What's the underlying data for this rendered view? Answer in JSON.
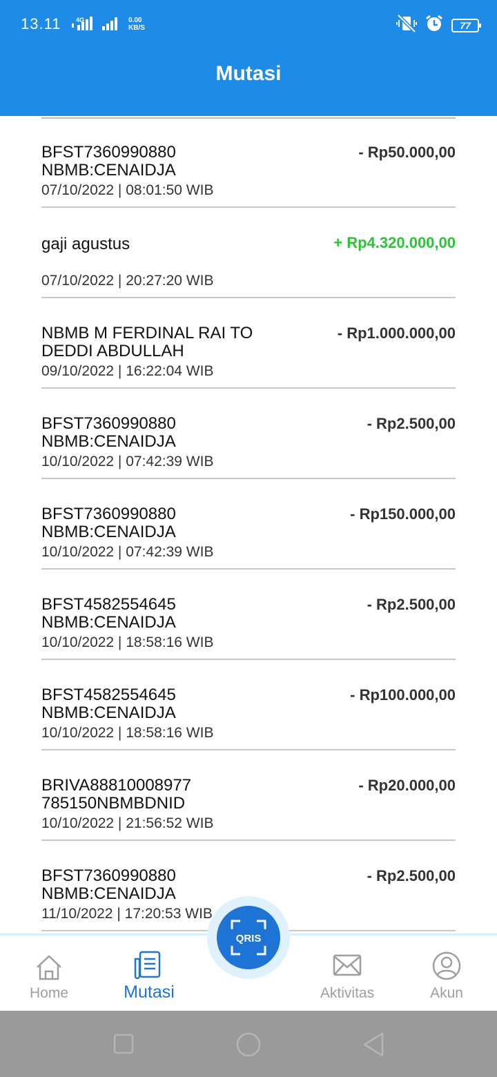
{
  "statusbar": {
    "time": "13.11",
    "network": "4G",
    "speed_value": "0.00",
    "speed_unit": "KB/S",
    "battery": "77"
  },
  "header": {
    "title": "Mutasi"
  },
  "transactions": [
    {
      "desc": "BFST7360990880 NBMB:CENAIDJA",
      "date": "07/10/2022 | 08:01:50 WIB",
      "amount": "- Rp50.000,00",
      "type": "debit"
    },
    {
      "desc": "gaji agustus",
      "date": "07/10/2022 | 20:27:20 WIB",
      "amount": "+ Rp4.320.000,00",
      "type": "credit"
    },
    {
      "desc": "NBMB M FERDINAL RAI TO DEDDI ABDULLAH",
      "date": "09/10/2022 | 16:22:04 WIB",
      "amount": "- Rp1.000.000,00",
      "type": "debit"
    },
    {
      "desc": "BFST7360990880 NBMB:CENAIDJA",
      "date": "10/10/2022 | 07:42:39 WIB",
      "amount": "- Rp2.500,00",
      "type": "debit"
    },
    {
      "desc": "BFST7360990880 NBMB:CENAIDJA",
      "date": "10/10/2022 | 07:42:39 WIB",
      "amount": "- Rp150.000,00",
      "type": "debit"
    },
    {
      "desc": "BFST4582554645 NBMB:CENAIDJA",
      "date": "10/10/2022 | 18:58:16 WIB",
      "amount": "- Rp2.500,00",
      "type": "debit"
    },
    {
      "desc": "BFST4582554645 NBMB:CENAIDJA",
      "date": "10/10/2022 | 18:58:16 WIB",
      "amount": "- Rp100.000,00",
      "type": "debit"
    },
    {
      "desc": "BRIVA88810008977 785150NBMBDNID",
      "date": "10/10/2022 | 21:56:52 WIB",
      "amount": "- Rp20.000,00",
      "type": "debit"
    },
    {
      "desc": "BFST7360990880 NBMB:CENAIDJA",
      "date": "11/10/2022 | 17:20:53 WIB",
      "amount": "- Rp2.500,00",
      "type": "debit"
    }
  ],
  "bottomnav": {
    "home": "Home",
    "mutasi": "Mutasi",
    "qris": "QRIS",
    "aktivitas": "Aktivitas",
    "akun": "Akun"
  },
  "colors": {
    "header": "#1e8be6",
    "active": "#1e74d4",
    "credit": "#2ec23a",
    "debit": "#333333"
  }
}
